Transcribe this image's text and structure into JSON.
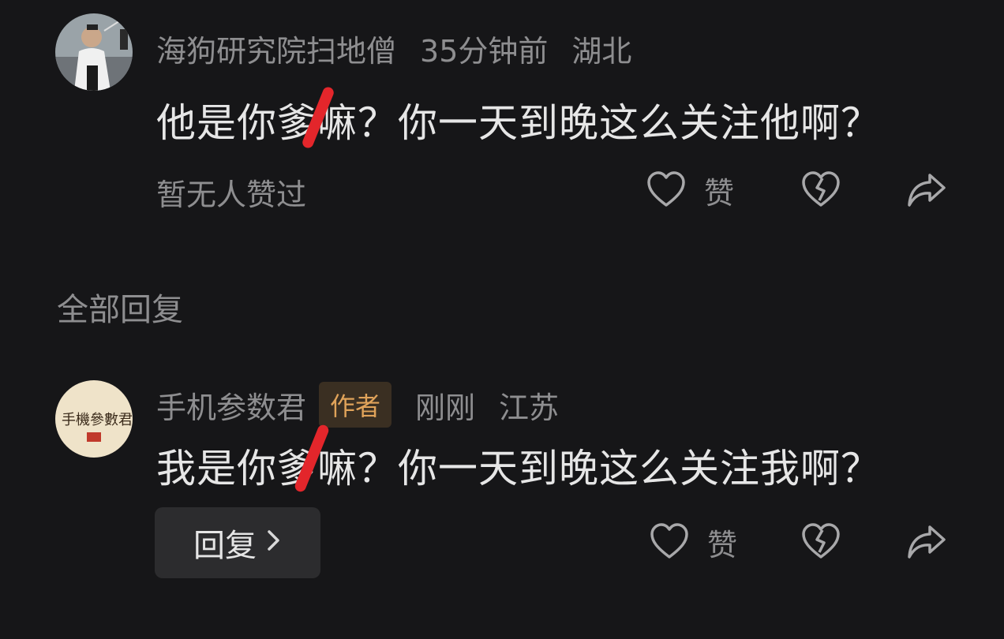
{
  "section_title": "全部回复",
  "comments": [
    {
      "username": "海狗研究院扫地僧",
      "time": "35分钟前",
      "location": "湖北",
      "text": "他是你爹嘛？你一天到晚这么关注他啊？",
      "like_status": "暂无人赞过",
      "like_label": "赞",
      "icons": [
        "heart-outline-icon",
        "broken-heart-icon",
        "share-arrow-icon"
      ]
    },
    {
      "username": "手机参数君",
      "badge": "作者",
      "time": "刚刚",
      "location": "江苏",
      "text": "我是你爹嘛？你一天到晚这么关注我啊？",
      "reply_button": "回复",
      "like_label": "赞",
      "icons": [
        "heart-outline-icon",
        "broken-heart-icon",
        "share-arrow-icon"
      ]
    }
  ],
  "colors": {
    "background": "#161618",
    "text_primary": "#e6e6e6",
    "text_secondary": "#8e8e90",
    "badge_text": "#e0a35a",
    "badge_bg": "#3a2f22",
    "redaction": "#e3262b"
  }
}
